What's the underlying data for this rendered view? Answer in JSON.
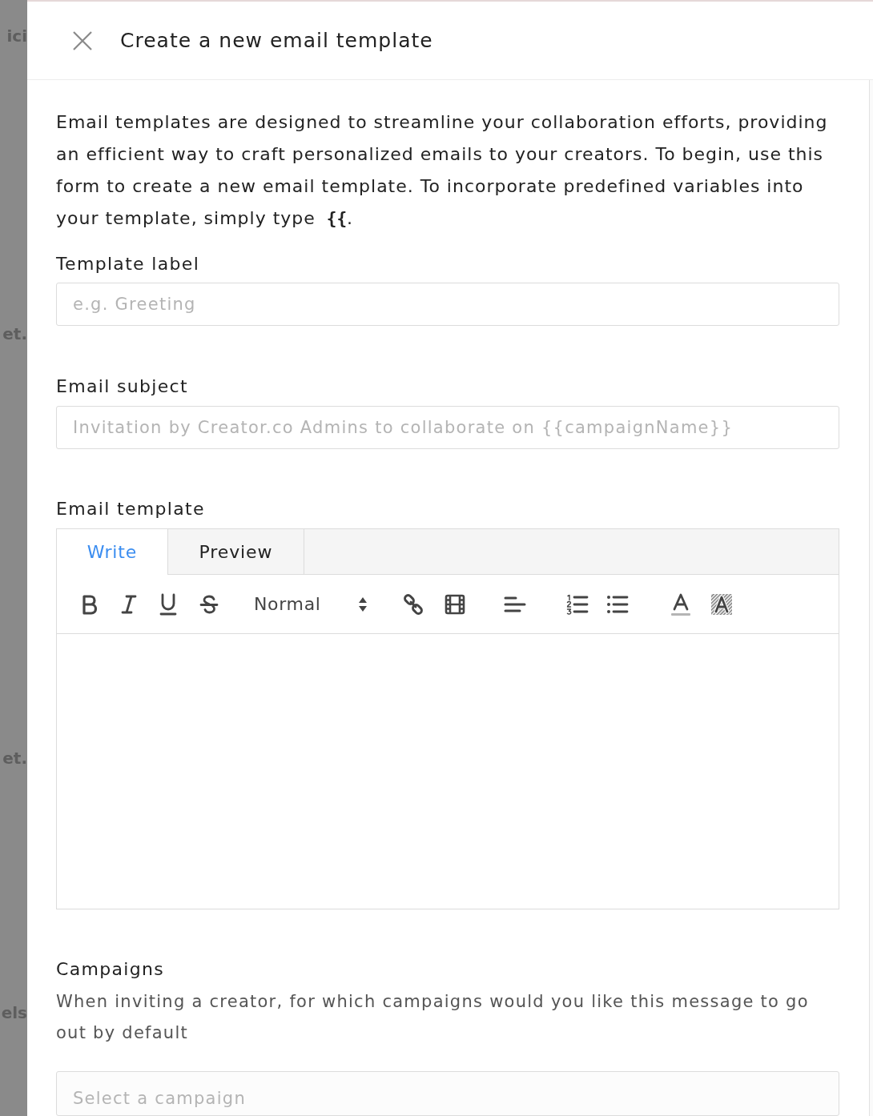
{
  "background_fragments": [
    "ici",
    "et.",
    "et.",
    "els"
  ],
  "drawer": {
    "title": "Create a new email template"
  },
  "intro": {
    "text": "Email templates are designed to streamline your collaboration efforts, providing an efficient way to craft personalized emails to your creators. To begin, use this form to create a new email template. To incorporate predefined variables into your template, simply type",
    "code": "{{",
    "end": "."
  },
  "template_label": {
    "label": "Template label",
    "placeholder": "e.g. Greeting"
  },
  "email_subject": {
    "label": "Email subject",
    "placeholder": "Invitation by Creator.co Admins to collaborate on {{campaignName}}"
  },
  "email_template": {
    "label": "Email template",
    "tabs": [
      {
        "label": "Write",
        "selected": true
      },
      {
        "label": "Preview",
        "selected": false
      }
    ],
    "toolbar": [
      {
        "kind": "bold"
      },
      {
        "kind": "italic"
      },
      {
        "kind": "underline"
      },
      {
        "kind": "strike"
      },
      {
        "kind": "format",
        "label": "Normal"
      },
      {
        "kind": "link"
      },
      {
        "kind": "video"
      },
      {
        "kind": "align"
      },
      {
        "kind": "ordered"
      },
      {
        "kind": "bullet"
      },
      {
        "kind": "color"
      },
      {
        "kind": "background"
      }
    ]
  },
  "campaigns": {
    "label": "Campaigns",
    "description": "When inviting a creator, for which campaigns would you like this message to go out by default",
    "placeholder": "Select a campaign"
  }
}
